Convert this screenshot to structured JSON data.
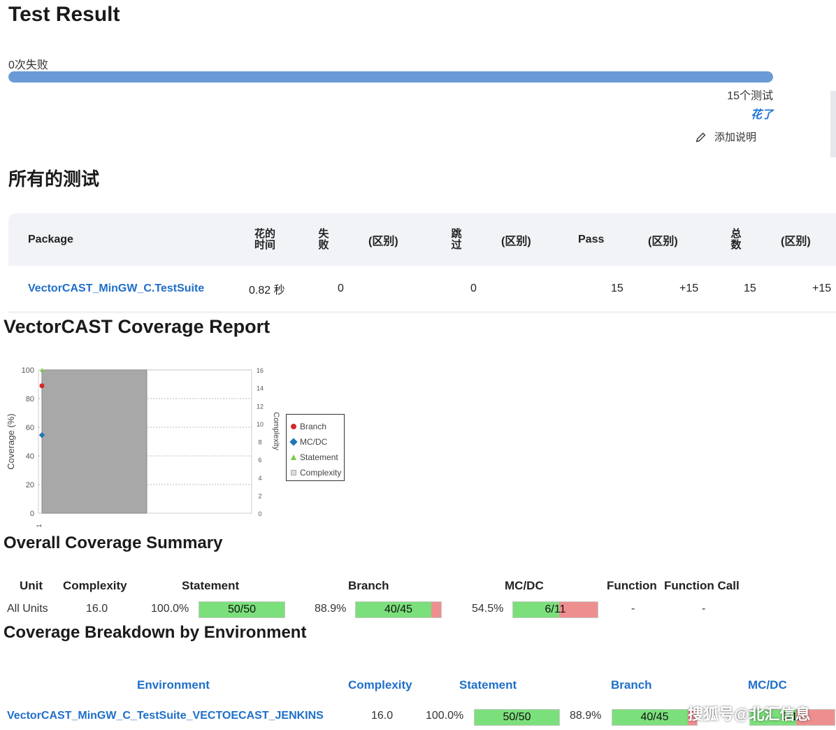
{
  "test_result": {
    "title": "Test Result",
    "fail_count": "0次失败",
    "progress_pass_fraction": 1.0,
    "total_tests": "15个测试",
    "took_link": "花了",
    "add_description": "添加说明"
  },
  "all_tests": {
    "title": "所有的测试",
    "columns": [
      "Package",
      "花的时间",
      "失败",
      "(区别)",
      "跳过",
      "(区别)",
      "Pass",
      "(区别)",
      "总数",
      "(区别)"
    ],
    "row": {
      "package": "VectorCAST_MinGW_C.TestSuite",
      "duration": "0.82 秒",
      "fail": "0",
      "fail_diff": "",
      "skip": "0",
      "skip_diff": "",
      "pass": "15",
      "pass_diff": "+15",
      "total": "15",
      "total_diff": "+15"
    }
  },
  "coverage_report": {
    "title": "VectorCAST Coverage Report"
  },
  "chart_data": {
    "type": "bar",
    "categories": [
      "1"
    ],
    "series": [
      {
        "name": "Branch",
        "values": [
          88.9
        ],
        "color": "#d62728"
      },
      {
        "name": "MC/DC",
        "values": [
          54.5
        ],
        "color": "#1f77b4"
      },
      {
        "name": "Statement",
        "values": [
          100.0
        ],
        "color": "#7ac943"
      },
      {
        "name": "Complexity",
        "values": [
          16
        ],
        "color": "#a9a9a9",
        "axis": "right"
      }
    ],
    "ylabel": "Coverage (%)",
    "y2label": "Complexity",
    "ylim": [
      0,
      100
    ],
    "y2lim": [
      0,
      16
    ],
    "y_ticks": [
      "0",
      "20",
      "40",
      "60",
      "80",
      "100"
    ],
    "y2_ticks": [
      "0",
      "2",
      "4",
      "6",
      "8",
      "10",
      "12",
      "14",
      "16"
    ],
    "legend": [
      "Branch",
      "MC/DC",
      "Statement",
      "Complexity"
    ],
    "legend_position": "right",
    "grid": true
  },
  "overall_summary": {
    "title": "Overall Coverage Summary",
    "headers": {
      "unit": "Unit",
      "complexity": "Complexity",
      "statement": "Statement",
      "branch": "Branch",
      "mcdc": "MC/DC",
      "function": "Function",
      "function_call": "Function Call"
    },
    "row": {
      "unit": "All Units",
      "complexity": "16.0",
      "statement_pct": "100.0%",
      "statement_frac": "50/50",
      "statement_ratio": 1.0,
      "branch_pct": "88.9%",
      "branch_frac": "40/45",
      "branch_ratio": 0.889,
      "mcdc_pct": "54.5%",
      "mcdc_frac": "6/11",
      "mcdc_ratio": 0.545,
      "function": "-",
      "function_call": "-"
    }
  },
  "breakdown": {
    "title": "Coverage Breakdown by Environment",
    "headers": {
      "environment": "Environment",
      "complexity": "Complexity",
      "statement": "Statement",
      "branch": "Branch",
      "mcdc": "MC/DC"
    },
    "row": {
      "environment": "VectorCAST_MinGW_C_TestSuite_VECTOECAST_JENKINS",
      "complexity": "16.0",
      "statement_pct": "100.0%",
      "statement_frac": "50/50",
      "statement_ratio": 1.0,
      "branch_pct": "88.9%",
      "branch_frac": "40/45",
      "branch_ratio": 0.889,
      "mcdc_frac": "6/11",
      "mcdc_ratio": 0.545
    }
  },
  "watermark": "搜狐号@北汇信息",
  "colors": {
    "progress": "#6b9bd6",
    "link": "#1f6fc9",
    "bar_covered": "#7be07b",
    "bar_uncovered": "#ee8f8f"
  }
}
